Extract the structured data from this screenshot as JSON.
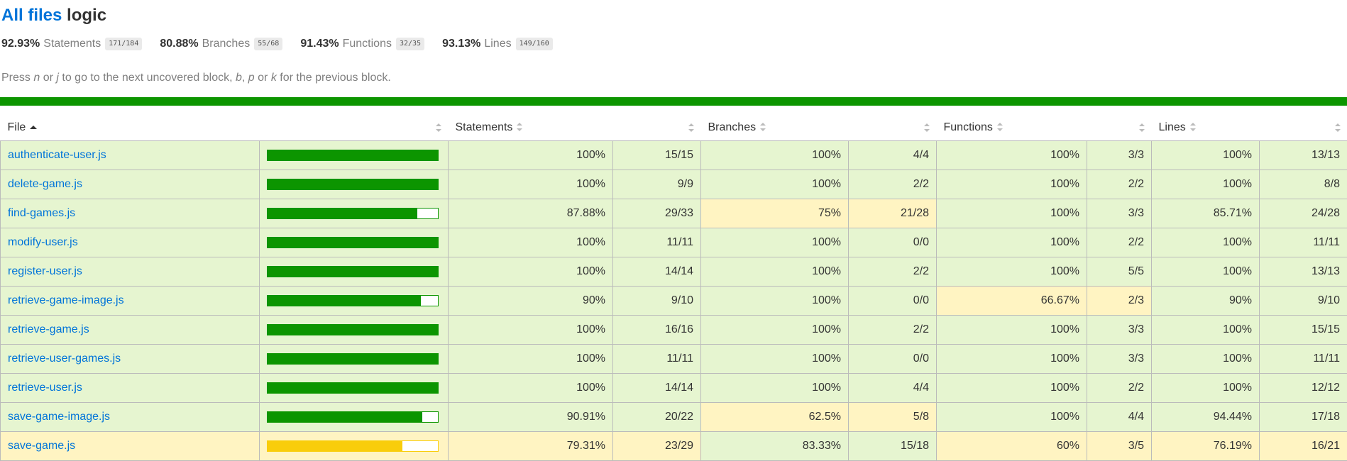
{
  "title": {
    "link": "All files",
    "dir": "logic"
  },
  "summary": [
    {
      "pct": "92.93%",
      "label": "Statements",
      "frac": "171/184"
    },
    {
      "pct": "80.88%",
      "label": "Branches",
      "frac": "55/68"
    },
    {
      "pct": "91.43%",
      "label": "Functions",
      "frac": "32/35"
    },
    {
      "pct": "93.13%",
      "label": "Lines",
      "frac": "149/160"
    }
  ],
  "hint": {
    "p1": "Press ",
    "k1": "n",
    "p2": " or ",
    "k2": "j",
    "p3": " to go to the next uncovered block, ",
    "k3": "b",
    "p4": ", ",
    "k4": "p",
    "p5": " or ",
    "k5": "k",
    "p6": " for the previous block."
  },
  "columns": {
    "file": "File",
    "statements": "Statements",
    "branches": "Branches",
    "functions": "Functions",
    "lines": "Lines"
  },
  "rows": [
    {
      "file": "authenticate-user.js",
      "level": "high",
      "bar": 100,
      "stmt": "100%",
      "stmt_f": "15/15",
      "br": "100%",
      "br_f": "4/4",
      "fn": "100%",
      "fn_f": "3/3",
      "ln": "100%",
      "ln_f": "13/13",
      "stmt_c": "high",
      "br_c": "high",
      "fn_c": "high",
      "ln_c": "high"
    },
    {
      "file": "delete-game.js",
      "level": "high",
      "bar": 100,
      "stmt": "100%",
      "stmt_f": "9/9",
      "br": "100%",
      "br_f": "2/2",
      "fn": "100%",
      "fn_f": "2/2",
      "ln": "100%",
      "ln_f": "8/8",
      "stmt_c": "high",
      "br_c": "high",
      "fn_c": "high",
      "ln_c": "high"
    },
    {
      "file": "find-games.js",
      "level": "high",
      "bar": 87.88,
      "stmt": "87.88%",
      "stmt_f": "29/33",
      "br": "75%",
      "br_f": "21/28",
      "fn": "100%",
      "fn_f": "3/3",
      "ln": "85.71%",
      "ln_f": "24/28",
      "stmt_c": "high",
      "br_c": "medium",
      "fn_c": "high",
      "ln_c": "high"
    },
    {
      "file": "modify-user.js",
      "level": "high",
      "bar": 100,
      "stmt": "100%",
      "stmt_f": "11/11",
      "br": "100%",
      "br_f": "0/0",
      "fn": "100%",
      "fn_f": "2/2",
      "ln": "100%",
      "ln_f": "11/11",
      "stmt_c": "high",
      "br_c": "high",
      "fn_c": "high",
      "ln_c": "high"
    },
    {
      "file": "register-user.js",
      "level": "high",
      "bar": 100,
      "stmt": "100%",
      "stmt_f": "14/14",
      "br": "100%",
      "br_f": "2/2",
      "fn": "100%",
      "fn_f": "5/5",
      "ln": "100%",
      "ln_f": "13/13",
      "stmt_c": "high",
      "br_c": "high",
      "fn_c": "high",
      "ln_c": "high"
    },
    {
      "file": "retrieve-game-image.js",
      "level": "high",
      "bar": 90,
      "stmt": "90%",
      "stmt_f": "9/10",
      "br": "100%",
      "br_f": "0/0",
      "fn": "66.67%",
      "fn_f": "2/3",
      "ln": "90%",
      "ln_f": "9/10",
      "stmt_c": "high",
      "br_c": "high",
      "fn_c": "medium",
      "ln_c": "high"
    },
    {
      "file": "retrieve-game.js",
      "level": "high",
      "bar": 100,
      "stmt": "100%",
      "stmt_f": "16/16",
      "br": "100%",
      "br_f": "2/2",
      "fn": "100%",
      "fn_f": "3/3",
      "ln": "100%",
      "ln_f": "15/15",
      "stmt_c": "high",
      "br_c": "high",
      "fn_c": "high",
      "ln_c": "high"
    },
    {
      "file": "retrieve-user-games.js",
      "level": "high",
      "bar": 100,
      "stmt": "100%",
      "stmt_f": "11/11",
      "br": "100%",
      "br_f": "0/0",
      "fn": "100%",
      "fn_f": "3/3",
      "ln": "100%",
      "ln_f": "11/11",
      "stmt_c": "high",
      "br_c": "high",
      "fn_c": "high",
      "ln_c": "high"
    },
    {
      "file": "retrieve-user.js",
      "level": "high",
      "bar": 100,
      "stmt": "100%",
      "stmt_f": "14/14",
      "br": "100%",
      "br_f": "4/4",
      "fn": "100%",
      "fn_f": "2/2",
      "ln": "100%",
      "ln_f": "12/12",
      "stmt_c": "high",
      "br_c": "high",
      "fn_c": "high",
      "ln_c": "high"
    },
    {
      "file": "save-game-image.js",
      "level": "high",
      "bar": 90.91,
      "stmt": "90.91%",
      "stmt_f": "20/22",
      "br": "62.5%",
      "br_f": "5/8",
      "fn": "100%",
      "fn_f": "4/4",
      "ln": "94.44%",
      "ln_f": "17/18",
      "stmt_c": "high",
      "br_c": "medium",
      "fn_c": "high",
      "ln_c": "high"
    },
    {
      "file": "save-game.js",
      "level": "medium",
      "bar": 79.31,
      "stmt": "79.31%",
      "stmt_f": "23/29",
      "br": "83.33%",
      "br_f": "15/18",
      "fn": "60%",
      "fn_f": "3/5",
      "ln": "76.19%",
      "ln_f": "16/21",
      "stmt_c": "medium",
      "br_c": "high",
      "fn_c": "medium",
      "ln_c": "medium"
    }
  ]
}
